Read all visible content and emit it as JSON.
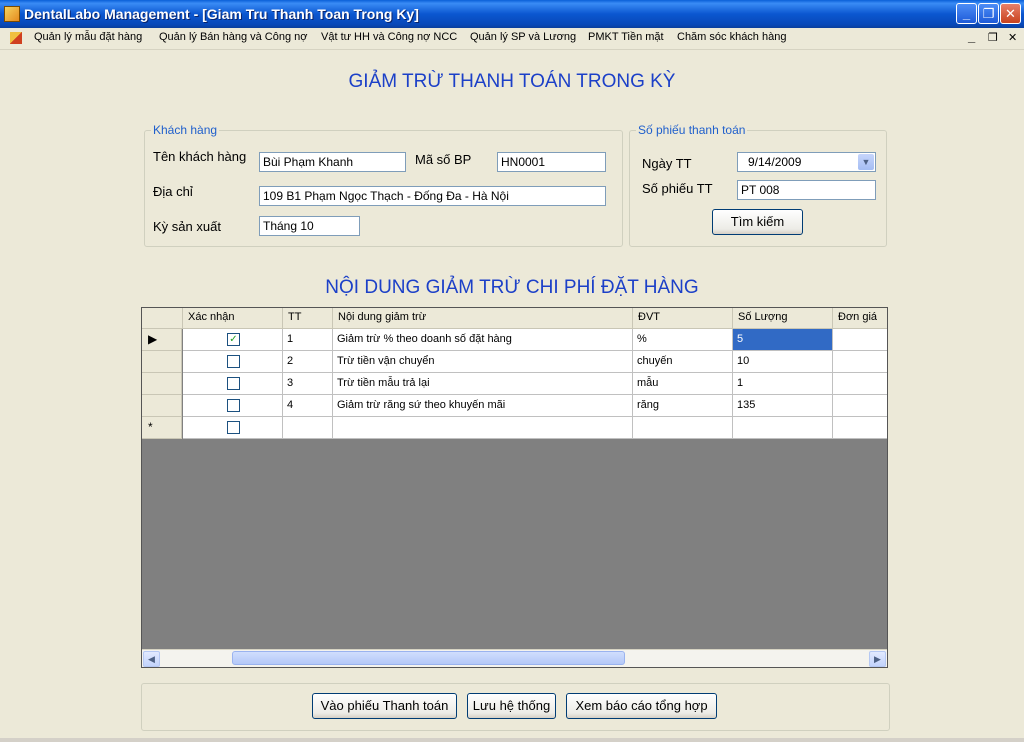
{
  "window": {
    "title": "DentalLabo Management - [Giam Tru Thanh Toan Trong Ky]",
    "minimize_label": "_",
    "restore_label": "❐",
    "close_label": "✕"
  },
  "menu": {
    "items": [
      "Quản lý mẫu đặt hàng",
      "Quản lý Bán hàng và Công nợ",
      "Vật tư HH và Công nợ NCC",
      "Quản lý SP và Lương",
      "PMKT Tiền mặt",
      "Chăm sóc khách hàng"
    ],
    "mdi_minimize": "_",
    "mdi_restore": "❐",
    "mdi_close": "✕"
  },
  "form": {
    "title": "GIẢM TRỪ THANH TOÁN TRONG KỲ",
    "customer_group": {
      "legend": "Khách hàng",
      "name_label": "Tên khách hàng",
      "name_value": "Bùi Phạm Khanh",
      "code_label": "Mã số BP",
      "code_value": "HN0001",
      "address_label": "Địa chỉ",
      "address_value": "109 B1 Phạm Ngọc Thạch - Đống Đa - Hà Nội",
      "period_label": "Kỳ sản xuất",
      "period_value": "Tháng 10"
    },
    "payment_group": {
      "legend": "Số phiếu thanh toán",
      "date_label": "Ngày TT",
      "date_value": "9/14/2009",
      "voucher_label": "Số phiếu TT",
      "voucher_value": "PT 008",
      "search_button": "Tìm kiếm"
    },
    "grid_title": "NỘI DUNG GIẢM TRỪ CHI PHÍ ĐẶT HÀNG",
    "grid": {
      "columns": [
        "Xác nhận",
        "TT",
        "Nội dung giảm trừ",
        "ĐVT",
        "Số Lượng",
        "Đơn giá"
      ],
      "rows": [
        {
          "checked": true,
          "tt": "1",
          "content": "Giảm trừ % theo doanh số đặt hàng",
          "unit": "%",
          "qty": "5",
          "price": ""
        },
        {
          "checked": false,
          "tt": "2",
          "content": "Trừ tiền vận chuyển",
          "unit": "chuyến",
          "qty": "10",
          "price": ""
        },
        {
          "checked": false,
          "tt": "3",
          "content": "Trừ tiền mẫu trả lại",
          "unit": "mẫu",
          "qty": "1",
          "price": ""
        },
        {
          "checked": false,
          "tt": "4",
          "content": "Giảm trừ răng sứ theo khuyến mãi",
          "unit": "răng",
          "qty": "135",
          "price": ""
        }
      ],
      "current_row_marker": "▶",
      "new_row_marker": "*"
    },
    "buttons": {
      "payment": "Vào phiếu Thanh toán",
      "save": "Lưu hệ thống",
      "report": "Xem báo cáo tổng hợp"
    }
  }
}
